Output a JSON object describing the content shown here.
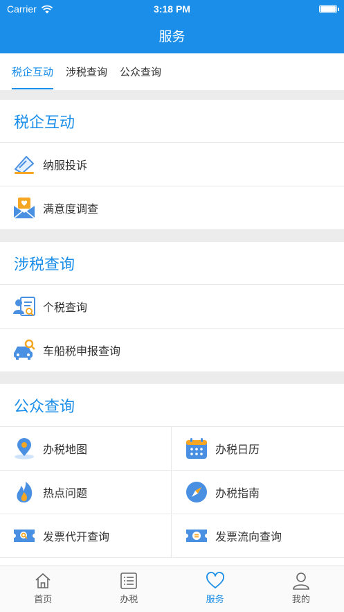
{
  "status_bar": {
    "carrier": "Carrier",
    "time": "3:18 PM"
  },
  "nav": {
    "title": "服务"
  },
  "tabs": [
    {
      "label": "税企互动",
      "active": true
    },
    {
      "label": "涉税查询",
      "active": false
    },
    {
      "label": "公众查询",
      "active": false
    }
  ],
  "sections": {
    "interaction": {
      "title": "税企互动",
      "items": [
        {
          "label": "纳服投诉",
          "icon": "complaint-icon"
        },
        {
          "label": "满意度调查",
          "icon": "satisfaction-survey-icon"
        }
      ]
    },
    "tax_query": {
      "title": "涉税查询",
      "items": [
        {
          "label": "个税查询",
          "icon": "personal-tax-icon"
        },
        {
          "label": "车船税申报查询",
          "icon": "vehicle-tax-icon"
        }
      ]
    },
    "public_query": {
      "title": "公众查询",
      "items": [
        {
          "label": "办税地图",
          "icon": "map-pin-icon"
        },
        {
          "label": "办税日历",
          "icon": "calendar-icon"
        },
        {
          "label": "热点问题",
          "icon": "flame-icon"
        },
        {
          "label": "办税指南",
          "icon": "compass-icon"
        },
        {
          "label": "发票代开查询",
          "icon": "invoice-search-icon"
        },
        {
          "label": "发票流向查询",
          "icon": "invoice-flow-icon"
        }
      ]
    }
  },
  "tabbar": [
    {
      "label": "首页",
      "icon": "home-icon",
      "active": false
    },
    {
      "label": "办税",
      "icon": "list-icon",
      "active": false
    },
    {
      "label": "服务",
      "icon": "heart-icon",
      "active": true
    },
    {
      "label": "我的",
      "icon": "user-icon",
      "active": false
    }
  ],
  "colors": {
    "primary": "#1a8ee8",
    "divider": "#ececec"
  }
}
